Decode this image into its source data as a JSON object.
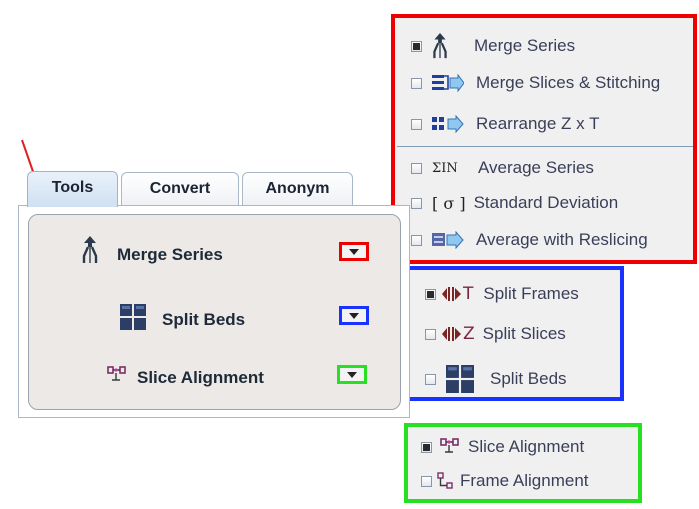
{
  "tabs": [
    {
      "label": "Tools",
      "active": true
    },
    {
      "label": "Convert",
      "active": false
    },
    {
      "label": "Anonym",
      "active": false
    }
  ],
  "tools": [
    {
      "label": "Merge Series",
      "icon": "merge-series-icon",
      "button_color": "#e00000"
    },
    {
      "label": "Split Beds",
      "icon": "split-beds-icon",
      "button_color": "#1a32ff"
    },
    {
      "label": "Slice Alignment",
      "icon": "slice-alignment-icon",
      "button_color": "#27e021"
    }
  ],
  "menus": {
    "merge": [
      {
        "label": "Merge Series",
        "checked": true,
        "icon": "merge-series-icon"
      },
      {
        "label": "Merge Slices & Stitching",
        "checked": false,
        "icon": "merge-slices-icon"
      },
      {
        "label": "Rearrange Z x T",
        "checked": false,
        "icon": "rearrange-icon"
      },
      {
        "label": "Average Series",
        "checked": false,
        "icon": "average-series-icon",
        "glyph": "ΣIN"
      },
      {
        "label": "Standard Deviation",
        "checked": false,
        "icon": "std-deviation-icon",
        "glyph": "[ σ ]"
      },
      {
        "label": "Average with Reslicing",
        "checked": false,
        "icon": "average-reslicing-icon"
      }
    ],
    "split": [
      {
        "label": "Split Frames",
        "checked": true,
        "icon": "split-frames-icon",
        "glyph": "T"
      },
      {
        "label": "Split Slices",
        "checked": false,
        "icon": "split-slices-icon",
        "glyph": "Z"
      },
      {
        "label": "Split Beds",
        "checked": false,
        "icon": "split-beds-icon"
      }
    ],
    "alignment": [
      {
        "label": "Slice Alignment",
        "checked": true,
        "icon": "slice-alignment-icon"
      },
      {
        "label": "Frame Alignment",
        "checked": false,
        "icon": "frame-alignment-icon"
      }
    ]
  },
  "colors": {
    "red": "#e00000",
    "blue": "#1a32ff",
    "green": "#27e021",
    "arrow": "#e02020"
  }
}
